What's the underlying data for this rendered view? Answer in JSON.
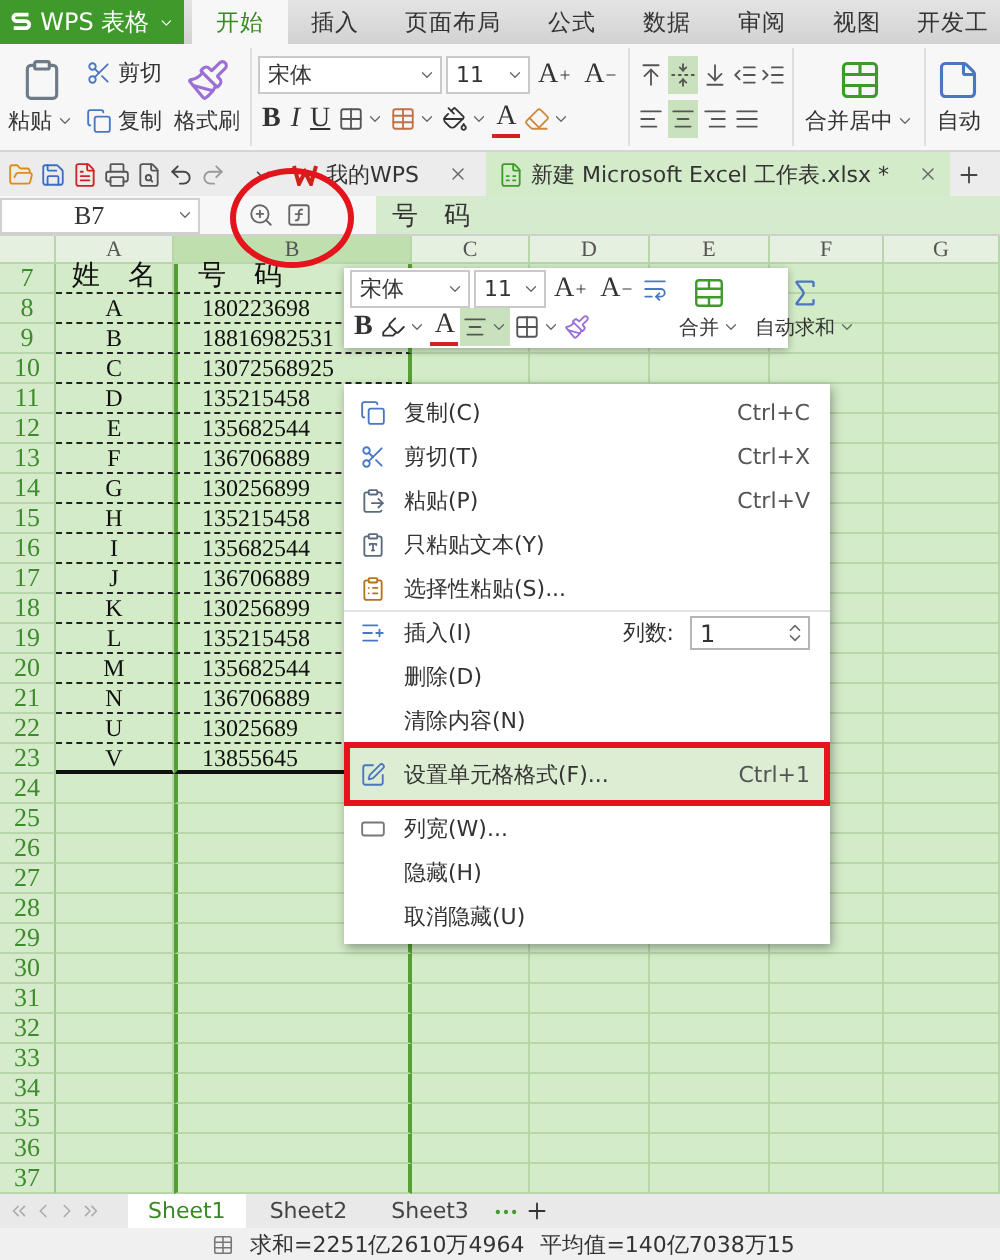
{
  "app_menu": {
    "label": "WPS 表格"
  },
  "ribbon_tabs": [
    {
      "label": "开始",
      "selected": true
    },
    {
      "label": "插入",
      "selected": false
    },
    {
      "label": "页面布局",
      "selected": false
    },
    {
      "label": "公式",
      "selected": false
    },
    {
      "label": "数据",
      "selected": false
    },
    {
      "label": "审阅",
      "selected": false
    },
    {
      "label": "视图",
      "selected": false
    },
    {
      "label": "开发工",
      "selected": false
    }
  ],
  "ribbon": {
    "paste": "粘贴",
    "cut": "剪切",
    "copy": "复制",
    "format_painter": "格式刷",
    "font_name": "宋体",
    "font_size": "11",
    "grow": "A",
    "shrink": "A",
    "bold": "B",
    "italic": "I",
    "underline": "U",
    "font_color": "A",
    "vertical_align": [
      {
        "selected": false
      },
      {
        "selected": true
      },
      {
        "selected": false
      }
    ],
    "horizontal_align": [
      {
        "selected": false
      },
      {
        "selected": true
      },
      {
        "selected": false
      },
      {
        "selected": false
      }
    ],
    "merge": "合并居中",
    "autosum": "自动"
  },
  "doc_tabs": [
    {
      "label": "我的WPS",
      "kind": "home",
      "selected": false
    },
    {
      "label": "新建 Microsoft Excel 工作表.xlsx *",
      "kind": "sheet",
      "selected": true
    }
  ],
  "formula_bar": {
    "cell_ref": "B7",
    "content": "号　码",
    "circled": true
  },
  "columns": [
    {
      "label": "A",
      "selected": false
    },
    {
      "label": "B",
      "selected": true
    },
    {
      "label": "C",
      "selected": false
    },
    {
      "label": "D",
      "selected": false
    },
    {
      "label": "E",
      "selected": false
    },
    {
      "label": "F",
      "selected": false
    },
    {
      "label": "G",
      "selected": false
    }
  ],
  "rows": [
    {
      "number": "7",
      "a": "姓　名",
      "b": "号　码"
    },
    {
      "number": "8",
      "a": "A",
      "b": "180223698"
    },
    {
      "number": "9",
      "a": "B",
      "b": "18816982531"
    },
    {
      "number": "10",
      "a": "C",
      "b": "13072568925"
    },
    {
      "number": "11",
      "a": "D",
      "b": "135215458"
    },
    {
      "number": "12",
      "a": "E",
      "b": "135682544"
    },
    {
      "number": "13",
      "a": "F",
      "b": "136706889"
    },
    {
      "number": "14",
      "a": "G",
      "b": "130256899"
    },
    {
      "number": "15",
      "a": "H",
      "b": "135215458"
    },
    {
      "number": "16",
      "a": "I",
      "b": "135682544"
    },
    {
      "number": "17",
      "a": "J",
      "b": "136706889"
    },
    {
      "number": "18",
      "a": "K",
      "b": "130256899"
    },
    {
      "number": "19",
      "a": "L",
      "b": "135215458"
    },
    {
      "number": "20",
      "a": "M",
      "b": "135682544"
    },
    {
      "number": "21",
      "a": "N",
      "b": "136706889"
    },
    {
      "number": "22",
      "a": "U",
      "b": "13025689"
    },
    {
      "number": "23",
      "a": "V",
      "b": "13855645"
    },
    {
      "number": "24"
    },
    {
      "number": "25"
    },
    {
      "number": "26"
    },
    {
      "number": "27"
    },
    {
      "number": "28"
    },
    {
      "number": "29"
    },
    {
      "number": "30"
    },
    {
      "number": "31"
    },
    {
      "number": "32"
    },
    {
      "number": "33"
    },
    {
      "number": "34"
    },
    {
      "number": "35"
    },
    {
      "number": "36"
    },
    {
      "number": "37"
    }
  ],
  "mini_toolbar": {
    "font_name": "宋体",
    "font_size": "11",
    "grow": "A",
    "shrink": "A",
    "bold": "B",
    "font_color": "A",
    "align_selected": true,
    "merge": "合并",
    "autosum": "自动求和"
  },
  "context_menu": [
    {
      "kind": "copy",
      "label": "复制(C)",
      "shortcut": "Ctrl+C",
      "selected": false,
      "separator_before": false
    },
    {
      "kind": "cut",
      "label": "剪切(T)",
      "shortcut": "Ctrl+X",
      "selected": false,
      "separator_before": false
    },
    {
      "kind": "paste",
      "label": "粘贴(P)",
      "shortcut": "Ctrl+V",
      "selected": false,
      "separator_before": false
    },
    {
      "kind": "paste_text",
      "label": "只粘贴文本(Y)",
      "selected": false,
      "separator_before": false
    },
    {
      "kind": "paste_special",
      "label": "选择性粘贴(S)...",
      "selected": false,
      "separator_before": false
    },
    {
      "kind": "insert",
      "label": "插入(I)",
      "count_label": "列数:",
      "count": "1",
      "selected": false,
      "separator_before": true
    },
    {
      "kind": "plain",
      "label": "删除(D)",
      "selected": false,
      "separator_before": false
    },
    {
      "kind": "plain",
      "label": "清除内容(N)",
      "selected": false,
      "separator_before": false
    },
    {
      "kind": "format",
      "label": "设置单元格格式(F)...",
      "shortcut": "Ctrl+1",
      "selected": true,
      "framed": true,
      "separator_before": true
    },
    {
      "kind": "width",
      "label": "列宽(W)...",
      "selected": false,
      "separator_before": false
    },
    {
      "kind": "plain",
      "label": "隐藏(H)",
      "selected": false,
      "separator_before": false
    },
    {
      "kind": "plain",
      "label": "取消隐藏(U)",
      "selected": false,
      "separator_before": false
    }
  ],
  "sheet_tabs": [
    {
      "label": "Sheet1",
      "selected": true
    },
    {
      "label": "Sheet2",
      "selected": false
    },
    {
      "label": "Sheet3",
      "selected": false
    }
  ],
  "status_bar": {
    "sum": "求和=2251亿2610万4964",
    "average": "平均值=140亿7038万15"
  }
}
